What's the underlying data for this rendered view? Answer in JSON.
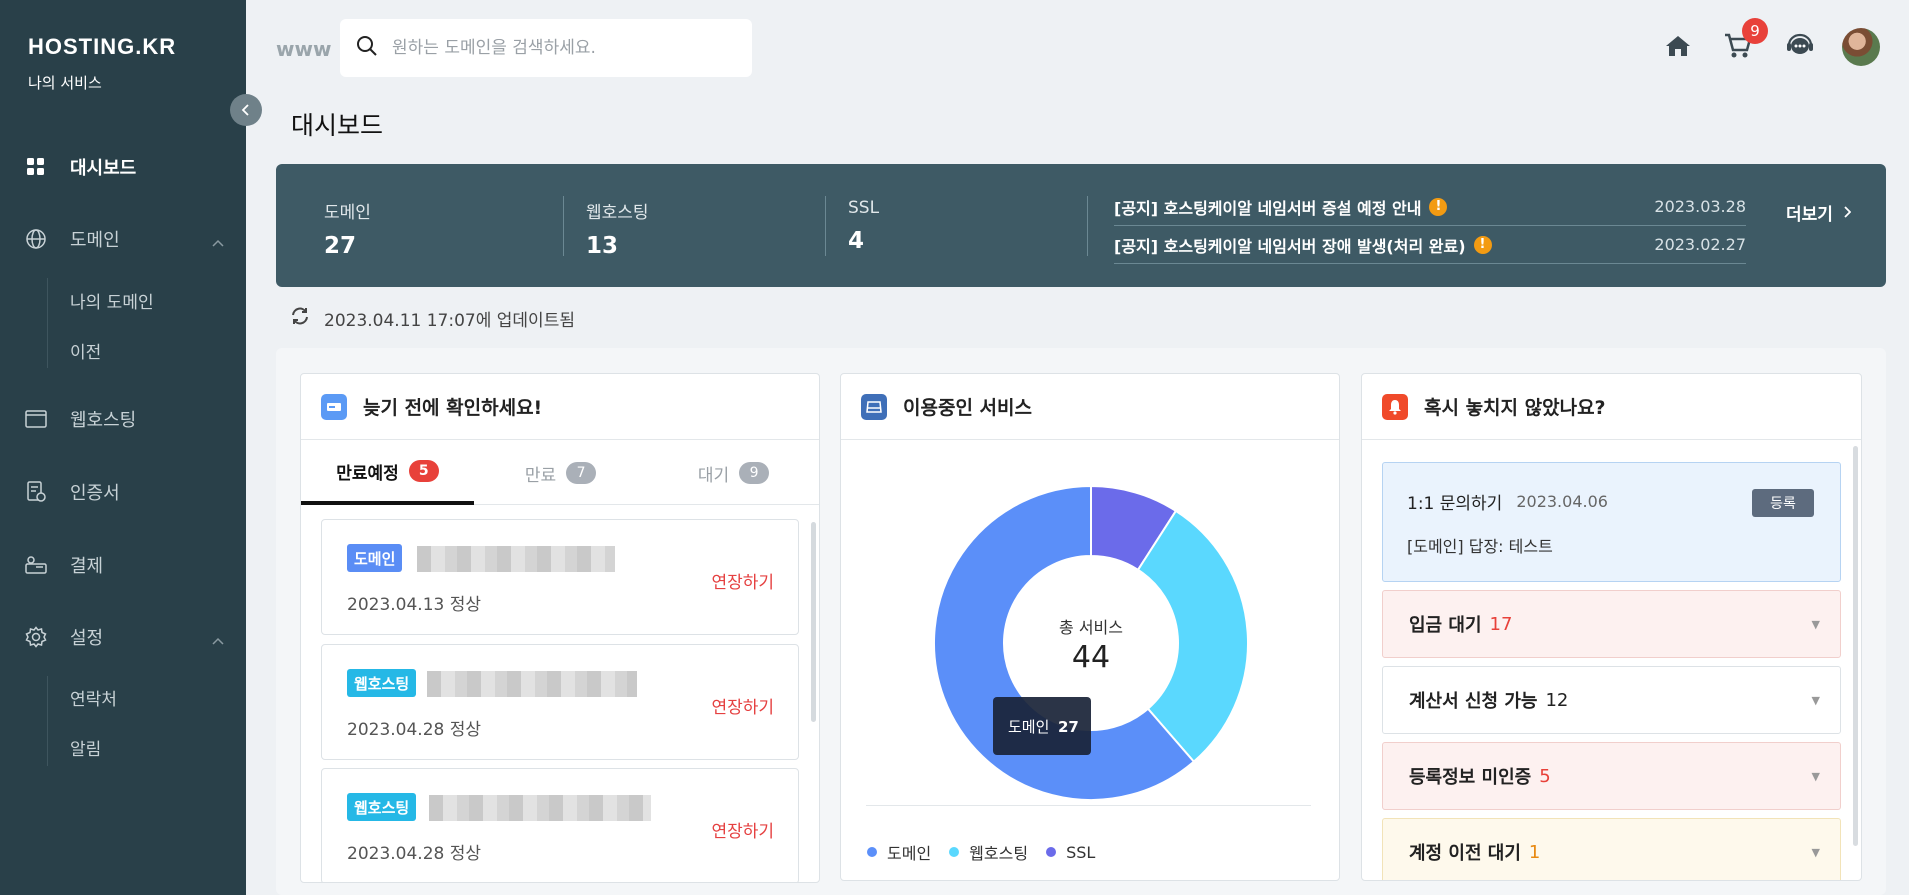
{
  "sidebar": {
    "logo": "HOSTING.KR",
    "subtitle": "나의 서비스",
    "items": [
      {
        "label": "대시보드",
        "icon": "grid-icon"
      },
      {
        "label": "도메인",
        "icon": "globe-icon"
      },
      {
        "label": "웹호스팅",
        "icon": "browser-window-icon"
      },
      {
        "label": "인증서",
        "icon": "certificate-icon"
      },
      {
        "label": "결제",
        "icon": "payment-icon"
      },
      {
        "label": "설정",
        "icon": "gear-icon"
      }
    ],
    "domain_sub": [
      "나의 도메인",
      "이전"
    ],
    "settings_sub": [
      "연락처",
      "알림"
    ]
  },
  "header": {
    "www": "www",
    "search_placeholder": "원하는 도메인을 검색하세요.",
    "cart_count": "9"
  },
  "page_title": "대시보드",
  "summary": {
    "stats": [
      {
        "label": "도메인",
        "value": "27"
      },
      {
        "label": "웹호스팅",
        "value": "13"
      },
      {
        "label": "SSL",
        "value": "4"
      }
    ],
    "notices": [
      {
        "title": "[공지] 호스팅케이알 네임서버 증설 예정 안내",
        "date": "2023.03.28"
      },
      {
        "title": "[공지] 호스팅케이알 네임서버 장애 발생(처리 완료)",
        "date": "2023.02.27"
      }
    ],
    "more": "더보기",
    "warn_glyph": "!"
  },
  "updated": "2023.04.11 17:07에 업데이트됨",
  "expiring": {
    "title": "늦기 전에 확인하세요!",
    "tabs": [
      {
        "label": "만료예정",
        "count": "5"
      },
      {
        "label": "만료",
        "count": "7"
      },
      {
        "label": "대기",
        "count": "9"
      }
    ],
    "items": [
      {
        "type": "도메인",
        "date": "2023.04.13 정상",
        "action": "연장하기"
      },
      {
        "type": "웹호스팅",
        "date": "2023.04.28 정상",
        "action": "연장하기"
      },
      {
        "type": "웹호스팅",
        "date": "2023.04.28 정상",
        "action": "연장하기"
      }
    ]
  },
  "services": {
    "title": "이용중인 서비스",
    "center_label": "총 서비스",
    "center_value": "44",
    "tooltip_label": "도메인",
    "tooltip_value": "27",
    "legend": [
      "도메인",
      "웹호스팅",
      "SSL"
    ],
    "colors": [
      "#5b8ff9",
      "#5ad8fe",
      "#6b6bea"
    ]
  },
  "chart_data": {
    "type": "pie",
    "categories": [
      "도메인",
      "웹호스팅",
      "SSL"
    ],
    "values": [
      27,
      13,
      4
    ],
    "title": "",
    "legend": "bottom"
  },
  "missed": {
    "title": "혹시 놓치지 않았나요?",
    "inquiry": {
      "title": "1:1 문의하기",
      "date": "2023.04.06",
      "button": "등록",
      "body": "[도메인] 답장: 테스트"
    },
    "rows": [
      {
        "label": "입금 대기",
        "count": "17",
        "color": "#e8413a"
      },
      {
        "label": "계산서 신청 가능",
        "count": "12",
        "color": "#222"
      },
      {
        "label": "등록정보 미인증",
        "count": "5",
        "color": "#e8413a"
      },
      {
        "label": "계정 이전 대기",
        "count": "1",
        "color": "#e88a12"
      }
    ]
  }
}
